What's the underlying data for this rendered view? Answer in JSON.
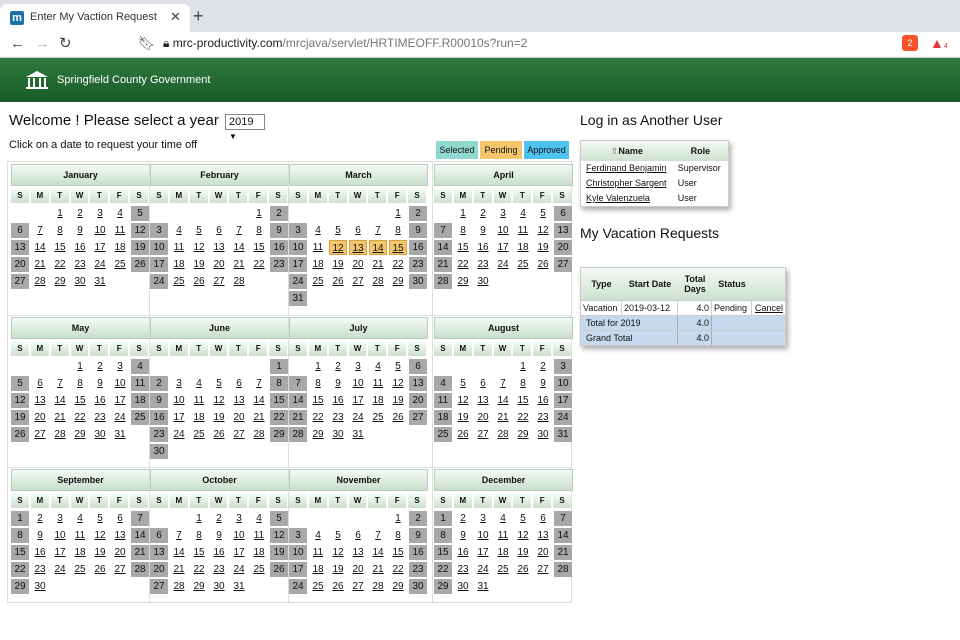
{
  "browser": {
    "tab_title": "Enter My Vaction Request",
    "favicon_letter": "m",
    "url_host": "mrc-productivity.com",
    "url_path": "/mrcjava/servlet/HRTIMEOFF.R00010s?run=2",
    "ext_badge_1": "2",
    "ext_badge_2": "4"
  },
  "banner": {
    "org_name": "Springfield County Government"
  },
  "page": {
    "welcome": "Welcome ! Please select a year",
    "year": "2019",
    "instruction": "Click on a date to request your time off"
  },
  "legend": {
    "selected": "Selected",
    "pending": "Pending",
    "approved": "Approved"
  },
  "colors": {
    "selected": "#8fd9d0",
    "pending": "#f5c56b",
    "approved": "#4ec3ef",
    "weekend": "#a8a8a8",
    "banner": "#1f6b2f"
  },
  "calendar": {
    "day_headers": [
      "S",
      "M",
      "T",
      "W",
      "T",
      "F",
      "S"
    ],
    "months": [
      {
        "name": "January",
        "start": 2,
        "days": 31
      },
      {
        "name": "February",
        "start": 5,
        "days": 28
      },
      {
        "name": "March",
        "start": 5,
        "days": 31
      },
      {
        "name": "April",
        "start": 1,
        "days": 30
      },
      {
        "name": "May",
        "start": 3,
        "days": 31
      },
      {
        "name": "June",
        "start": 6,
        "days": 30
      },
      {
        "name": "July",
        "start": 1,
        "days": 31
      },
      {
        "name": "August",
        "start": 4,
        "days": 31
      },
      {
        "name": "September",
        "start": 0,
        "days": 30
      },
      {
        "name": "October",
        "start": 2,
        "days": 31
      },
      {
        "name": "November",
        "start": 5,
        "days": 30
      },
      {
        "name": "December",
        "start": 0,
        "days": 31
      }
    ],
    "pending_dates": [
      {
        "month": 2,
        "days": [
          12,
          13,
          14,
          15
        ]
      }
    ]
  },
  "login": {
    "heading": "Log in as Another User",
    "col_name": "Name",
    "col_role": "Role",
    "users": [
      {
        "name": "Ferdinand Benjamin",
        "role": "Supervisor"
      },
      {
        "name": "Christopher Sargent",
        "role": "User"
      },
      {
        "name": "Kyle Valenzuela",
        "role": "User"
      }
    ]
  },
  "vacation": {
    "heading": "My Vacation Requests",
    "col_type": "Type",
    "col_start": "Start Date",
    "col_total": "Total Days",
    "col_status": "Status",
    "rows": [
      {
        "type": "Vacation",
        "start": "2019-03-12",
        "total": "4.0",
        "status": "Pending",
        "action": "Cancel"
      }
    ],
    "total_label": "Total for 2019",
    "total_value": "4.0",
    "grand_label": "Grand Total",
    "grand_value": "4.0"
  }
}
